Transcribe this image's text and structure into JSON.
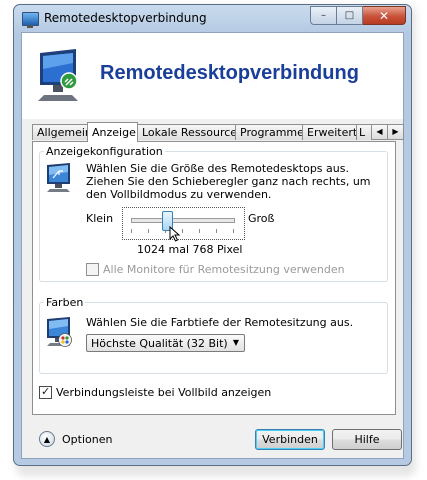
{
  "window": {
    "title": "Remotedesktopverbindung",
    "minimize_glyph": "–",
    "maximize_glyph": "□",
    "close_glyph": "✕"
  },
  "banner": {
    "title": "Remotedesktopverbindung",
    "icon": "remote-desktop-computer-icon"
  },
  "tabs": [
    {
      "label": "Allgemein",
      "active": false
    },
    {
      "label": "Anzeige",
      "active": true
    },
    {
      "label": "Lokale Ressourcen",
      "active": false
    },
    {
      "label": "Programme",
      "active": false
    },
    {
      "label": "Erweitert",
      "active": false
    },
    {
      "label": "L",
      "active": false
    }
  ],
  "tab_scroll": {
    "left": "◀",
    "right": "▶"
  },
  "display": {
    "legend": "Anzeigekonfiguration",
    "description": "Wählen Sie die Größe des Remotedesktops aus. Ziehen Sie den Schieberegler ganz nach rechts, um den Vollbildmodus zu verwenden.",
    "slider_min_label": "Klein",
    "slider_max_label": "Groß",
    "slider_value_fraction": 0.36,
    "resolution": "1024 mal 768 Pixel",
    "all_monitors_label": "Alle Monitore für Remotesitzung verwenden",
    "all_monitors_checked": false,
    "all_monitors_enabled": false
  },
  "colors": {
    "legend": "Farben",
    "description": "Wählen Sie die Farbtiefe der Remotesitzung aus.",
    "depth_selected": "Höchste Qualität (32 Bit)",
    "dropdown_arrow": "▼"
  },
  "connection_bar": {
    "label": "Verbindungsleiste bei Vollbild anzeigen",
    "checked": true
  },
  "footer": {
    "options_label": "Optionen",
    "options_glyph": "▲",
    "connect_label": "Verbinden",
    "help_label": "Hilfe"
  },
  "accent_colors": {
    "title_text": "#1a3f9a",
    "close_button": "#c9523a",
    "default_button_border": "#3c7fb1"
  }
}
